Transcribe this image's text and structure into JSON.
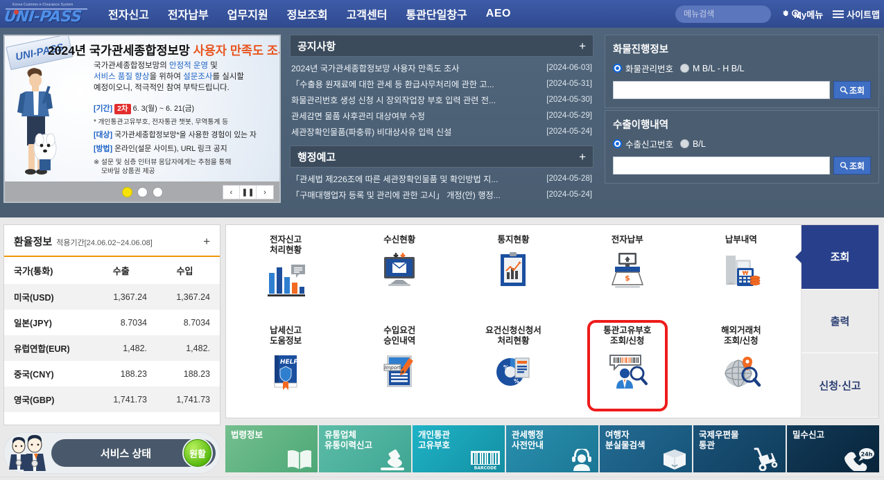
{
  "header": {
    "logo_tagline": "Korea Customs e-Clearance System",
    "logo_text": "UNI-PASS",
    "nav": [
      {
        "label": "전자신고"
      },
      {
        "label": "전자납부"
      },
      {
        "label": "업무지원"
      },
      {
        "label": "정보조회"
      },
      {
        "label": "고객센터"
      },
      {
        "label": "통관단일창구"
      },
      {
        "label": "AEO"
      }
    ],
    "search_placeholder": "메뉴검색",
    "search_value": "",
    "my_menu": "My메뉴",
    "sitemap": "사이트맵"
  },
  "banner": {
    "title_plain": "2024년 국가관세종합정보망 ",
    "title_highlight": "사용자 만족도 조사",
    "logo_text": "UNI-PASS",
    "sub_line1_a": "국가관세종합정보망의 ",
    "sub_line1_b": "안정적 운영",
    "sub_line1_c": " 및",
    "sub_line2_a": "서비스 품질 향상",
    "sub_line2_b": "을 위하여 ",
    "sub_line2_c": "설문조사",
    "sub_line2_d": "를 실시할",
    "sub_line3": "예정이오니, 적극적인 참여 부탁드립니다.",
    "item1_key": "[기간]",
    "item1_badge": "2차",
    "item1_text": "6. 3(월) ~ 6. 21(금)",
    "item1_note": "* 개인통관고유부호, 전자통관 챗봇, 무역통계 등",
    "item2_key": "[대상]",
    "item2_text": "국가관세종합정보망*을 사용한 경험이 있는 자",
    "item3_key": "[방법]",
    "item3_text": "온라인(설문 사이트), URL 링크 공지",
    "footnote_line1": "※ 설문 및 심층 인터뷰 응답자에게는 추첨을 통해",
    "footnote_line2": "모바일 상품권 제공",
    "slides_total": 3,
    "active_slide": 1,
    "prev": "‹",
    "pause": "❚❚",
    "next": "›"
  },
  "notices": {
    "title": "공지사항",
    "plus": "+",
    "items": [
      {
        "text": "2024년 국가관세종합정보망 사용자 만족도 조사",
        "date": "[2024-06-03]"
      },
      {
        "text": "「수출용 원재료에 대한 관세 등 환급사무처리에 관한 고...",
        "date": "[2024-05-31]"
      },
      {
        "text": "화물관리번호 생성 신청 시 장외작업장 부호 입력 관련 전...",
        "date": "[2024-05-30]"
      },
      {
        "text": "관세감면 물품 사후관리 대상여부 수정",
        "date": "[2024-05-29]"
      },
      {
        "text": "세관장확인물품(파충류) 비대상사유 입력 신설",
        "date": "[2024-05-24]"
      }
    ]
  },
  "admin_notices": {
    "title": "행정예고",
    "plus": "+",
    "items": [
      {
        "text": "「관세법 제226조에 따른 세관장확인물품 및 확인방법 지...",
        "date": "[2024-05-28]"
      },
      {
        "text": "「구매대행업자 등록 및 관리에 관한 고시」 개정(안) 행정...",
        "date": "[2024-05-24]"
      }
    ]
  },
  "cargo_box": {
    "title": "화물진행정보",
    "radio1": "화물관리번호",
    "radio2": "M B/L - H B/L",
    "selected": "화물관리번호",
    "input_value": "",
    "button": "조회"
  },
  "export_box": {
    "title": "수출이행내역",
    "radio1": "수출신고번호",
    "radio2": "B/L",
    "selected": "수출신고번호",
    "input_value": "",
    "button": "조회"
  },
  "fx": {
    "title": "환율정보",
    "period": "적용기간[24.06.02~24.06.08]",
    "plus": "+",
    "columns": [
      "국가(통화)",
      "수출",
      "수입"
    ],
    "rows": [
      {
        "country": "미국(USD)",
        "export": "1,367.24",
        "import": "1,367.24"
      },
      {
        "country": "일본(JPY)",
        "export": "8.7034",
        "import": "8.7034"
      },
      {
        "country": "유럽연합(EUR)",
        "export": "1,482.",
        "import": "1,482."
      },
      {
        "country": "중국(CNY)",
        "export": "188.23",
        "import": "188.23"
      },
      {
        "country": "영국(GBP)",
        "export": "1,741.73",
        "import": "1,741.73"
      }
    ]
  },
  "service_status": {
    "label": "서비스 상태",
    "badge": "원활",
    "badge_color": "#56b80e"
  },
  "service_grid": {
    "items": [
      {
        "label": "전자신고\n처리현황",
        "icon": "bar-chart-icon",
        "marked": false
      },
      {
        "label": "수신현황",
        "icon": "inbox-mail-icon",
        "marked": false
      },
      {
        "label": "통지현황",
        "icon": "clipboard-chart-icon",
        "marked": false
      },
      {
        "label": "전자납부",
        "icon": "payment-scanner-icon",
        "marked": false
      },
      {
        "label": "납부내역",
        "icon": "pos-terminal-icon",
        "marked": false
      },
      {
        "label": "납세신고\n도움정보",
        "icon": "help-book-icon",
        "marked": false
      },
      {
        "label": "수입요건\n승인내역",
        "icon": "import-document-icon",
        "marked": false
      },
      {
        "label": "요건신청신청서\n처리현황",
        "icon": "pie-document-icon",
        "marked": false
      },
      {
        "label": "통관고유부호\n조회/신청",
        "icon": "barcode-person-search-icon",
        "marked": true
      },
      {
        "label": "해외거래처\n조회/신청",
        "icon": "globe-search-icon",
        "marked": false
      }
    ],
    "tabs": [
      {
        "label": "조회",
        "active": true
      },
      {
        "label": "출력",
        "active": false
      },
      {
        "label": "신청·신고",
        "active": false
      }
    ]
  },
  "quick_links": [
    {
      "label": "법령정보",
      "color1": "#5bb27f",
      "color2": "#74bf8e",
      "icon": "open-book-icon"
    },
    {
      "label": "유통업체\n유통이력신고",
      "color1": "#49b09b",
      "color2": "#5cbda8",
      "icon": "stamp-icon"
    },
    {
      "label": "개인통관\n고유부호",
      "color1": "#19a7bd",
      "color2": "#1fb3c6",
      "icon": "barcode-icon"
    },
    {
      "label": "관세행정\n사전안내",
      "color1": "#1f7f9e",
      "color2": "#2a8fae",
      "icon": "person-headset-icon"
    },
    {
      "label": "여행자\n분실물검색",
      "color1": "#1c5f86",
      "color2": "#246b92",
      "icon": "box-icon"
    },
    {
      "label": "국제우편물\n통관",
      "color1": "#14476b",
      "color2": "#1a5278",
      "icon": "hand-truck-icon"
    },
    {
      "label": "밀수신고",
      "color1": "#0d2d46",
      "color2": "#123a58",
      "icon": "phone-24h-icon"
    }
  ]
}
